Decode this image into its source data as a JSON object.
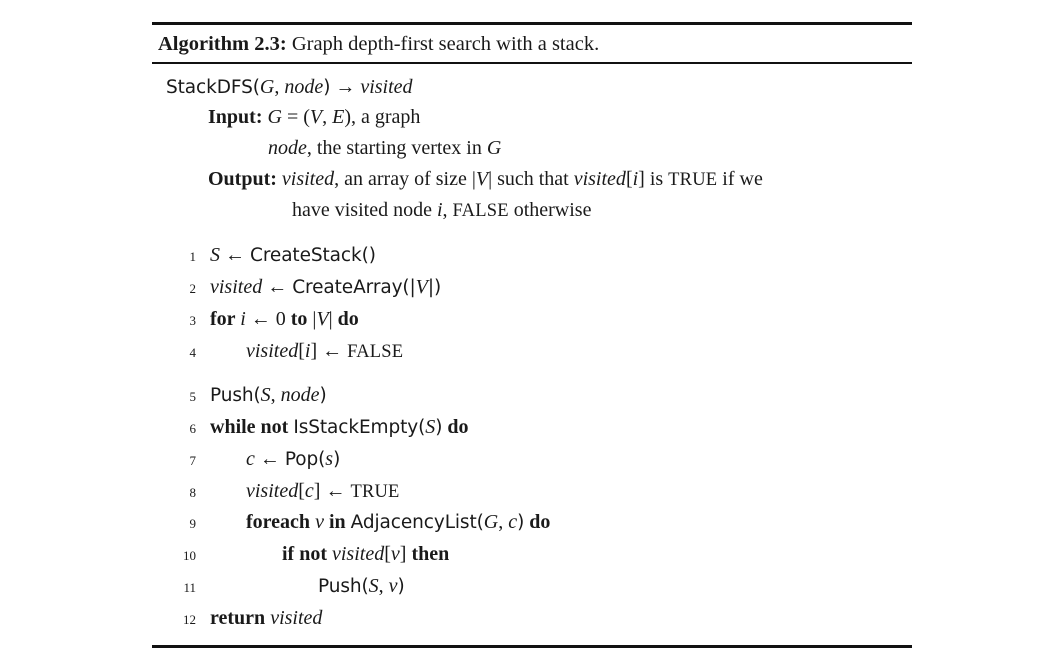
{
  "figure": {
    "caption_label": "Algorithm 2.3:",
    "caption_text": "Graph depth-first search with a stack.",
    "signature": {
      "name": "StackDFS",
      "open_paren": "(",
      "arg1": "G",
      "comma": ", ",
      "arg2": "node",
      "close_paren": ")",
      "arrow": "→",
      "returns": "visited"
    },
    "spec": {
      "input_label": "Input:",
      "input_line1": "G = (V, E), a graph",
      "input_line1_parts": {
        "g": "G",
        "eq": " = (",
        "v": "V",
        "comma": ", ",
        "e": "E",
        "rest": "), a graph"
      },
      "input_line2_parts": {
        "node": "node",
        "rest": ", the starting vertex in ",
        "g": "G"
      },
      "output_label": "Output:",
      "output_line1_parts": {
        "visited": "visited",
        "t1": ", an array of size |",
        "v": "V",
        "t2": "| such that ",
        "visited2": "visited",
        "t3": "[",
        "i": "i",
        "t4": "] is ",
        "true": "TRUE",
        "t5": " if we"
      },
      "output_line2_parts": {
        "t1": "have visited node ",
        "i": "i",
        "t2": ", ",
        "false": "FALSE",
        "t3": " otherwise"
      }
    },
    "code_lines": [
      {
        "number": "1",
        "indent": 0,
        "gap_before": false,
        "text": "S ← CreateStack()",
        "parts": {
          "s": "S",
          "arrow": " ← ",
          "fn": "CreateStack()"
        }
      },
      {
        "number": "2",
        "indent": 0,
        "gap_before": false,
        "text": "visited ← CreateArray(|V|)",
        "parts": {
          "visited": "visited",
          "arrow": " ← ",
          "fn1": "CreateArray(|",
          "v": "V",
          "fn2": "|)"
        }
      },
      {
        "number": "3",
        "indent": 0,
        "gap_before": false,
        "text": "for i ← 0 to |V| do",
        "parts": {
          "kw_for": "for ",
          "i": "i",
          "arrow": " ← ",
          "zero": "0",
          "kw_to": " to ",
          "bar1": "|",
          "v": "V",
          "bar2": "|",
          "kw_do": " do"
        }
      },
      {
        "number": "4",
        "indent": 1,
        "gap_before": false,
        "text": "visited[i] ← FALSE",
        "parts": {
          "visited": "visited",
          "lb": "[",
          "i": "i",
          "rb": "]",
          "arrow": " ← ",
          "false": "FALSE"
        }
      },
      {
        "number": "5",
        "indent": 0,
        "gap_before": true,
        "text": "Push(S, node)",
        "parts": {
          "fn": "Push(",
          "s": "S",
          "comma": ", ",
          "node": "node",
          "rp": ")"
        }
      },
      {
        "number": "6",
        "indent": 0,
        "gap_before": false,
        "text": "while not IsStackEmpty(S) do",
        "parts": {
          "kw_while": "while not ",
          "fn": "IsStackEmpty(",
          "s": "S",
          "rp": ")",
          "kw_do": " do"
        }
      },
      {
        "number": "7",
        "indent": 1,
        "gap_before": false,
        "text": "c ← Pop(s)",
        "parts": {
          "c": "c",
          "arrow": " ← ",
          "fn": "Pop(",
          "s": "s",
          "rp": ")"
        }
      },
      {
        "number": "8",
        "indent": 1,
        "gap_before": false,
        "text": "visited[c] ← TRUE",
        "parts": {
          "visited": "visited",
          "lb": "[",
          "c": "c",
          "rb": "]",
          "arrow": " ← ",
          "true": "TRUE"
        }
      },
      {
        "number": "9",
        "indent": 1,
        "gap_before": false,
        "text": "foreach v in AdjacencyList(G, c) do",
        "parts": {
          "kw_foreach": "foreach ",
          "v": "v",
          "kw_in": " in ",
          "fn": "AdjacencyList(",
          "g": "G",
          "comma": ", ",
          "c": "c",
          "rp": ")",
          "kw_do": " do"
        }
      },
      {
        "number": "10",
        "indent": 2,
        "gap_before": false,
        "text": "if not visited[v] then",
        "parts": {
          "kw_if": "if not ",
          "visited": "visited",
          "lb": "[",
          "v": "v",
          "rb": "]",
          "kw_then": " then"
        }
      },
      {
        "number": "11",
        "indent": 3,
        "gap_before": false,
        "text": "Push(S, v)",
        "parts": {
          "fn": "Push(",
          "s": "S",
          "comma": ", ",
          "v": "v",
          "rp": ")"
        }
      },
      {
        "number": "12",
        "indent": 0,
        "gap_before": false,
        "text": "return visited",
        "parts": {
          "kw_return": "return ",
          "visited": "visited"
        }
      }
    ]
  }
}
